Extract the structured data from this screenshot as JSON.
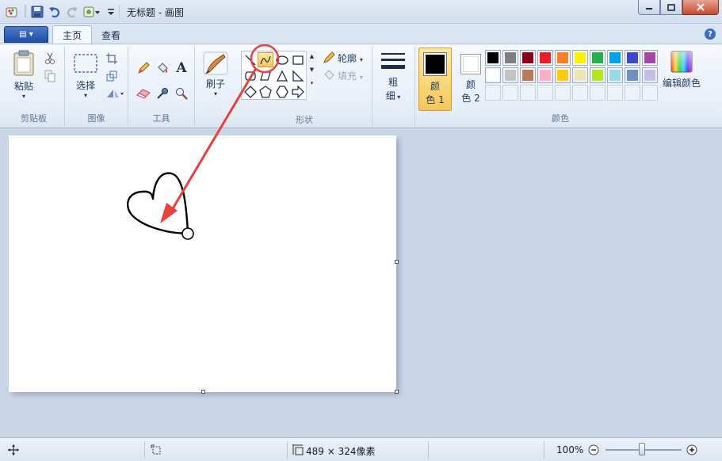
{
  "titlebar": {
    "title": "无标题 - 画图"
  },
  "tabs": {
    "file_menu": "▤ ▾",
    "home": "主页",
    "view": "查看",
    "help": "?"
  },
  "clipboard": {
    "paste": "粘贴",
    "group": "剪贴板"
  },
  "image": {
    "select": "选择",
    "group": "图像"
  },
  "tools": {
    "group": "工具"
  },
  "brushes": {
    "label": "刷子"
  },
  "shapes": {
    "outline": "轮廓",
    "fill": "填充",
    "group": "形状"
  },
  "size": {
    "label_top": "粗",
    "label_bottom": "细"
  },
  "colors": {
    "color1_top": "颜",
    "color1_bottom": "色 1",
    "color2_top": "颜",
    "color2_bottom": "色 2",
    "edit": "编辑颜色",
    "group": "颜色",
    "color1_value": "#000000",
    "color2_value": "#ffffff",
    "palette_row1": [
      "#000000",
      "#7f7f7f",
      "#880015",
      "#ed1c24",
      "#ff7f27",
      "#fff200",
      "#22b14c",
      "#00a2e8",
      "#3f48cc",
      "#a349a4"
    ],
    "palette_row2": [
      "#ffffff",
      "#c3c3c3",
      "#b97a57",
      "#ffaec9",
      "#ffc90e",
      "#efe4b0",
      "#b5e61d",
      "#99d9ea",
      "#7092be",
      "#c8bfe7"
    ]
  },
  "status": {
    "size": "489 × 324像素",
    "zoom": "100%"
  },
  "accent": {
    "annotation_red": "#e8403a",
    "selected_shape": "#f6c75a"
  }
}
